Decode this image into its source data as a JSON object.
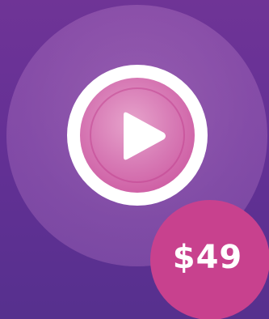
{
  "video": {
    "play_icon": "play-icon"
  },
  "price": {
    "label": "$49"
  },
  "colors": {
    "background": "#643095",
    "halo": "#a36bb8",
    "play_ring": "#ffffff",
    "play_inner": "#d77ab5",
    "badge": "#c8418e",
    "badge_text": "#ffffff"
  }
}
